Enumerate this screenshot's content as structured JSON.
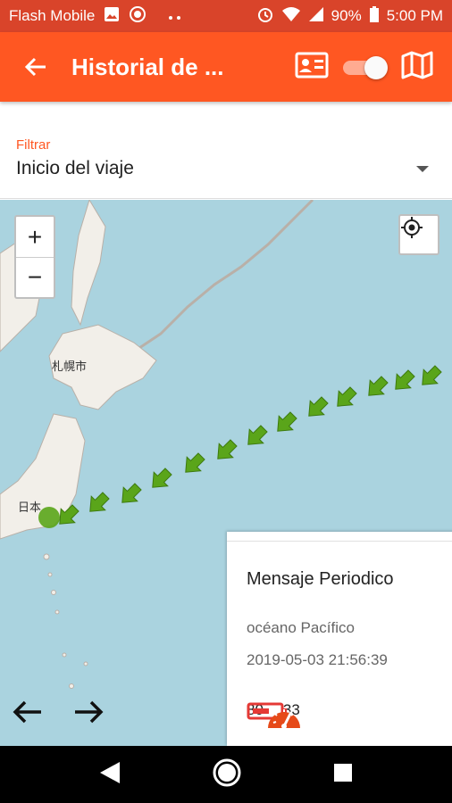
{
  "status_bar": {
    "carrier": "Flash Mobile",
    "battery": "90%",
    "time": "5:00 PM"
  },
  "app_bar": {
    "title": "Historial de ...",
    "icons": [
      "arrow-back-icon",
      "contact-card-icon",
      "map-icon"
    ],
    "toggle_on": true
  },
  "filter": {
    "label": "Filtrar",
    "selected": "Inicio del viaje"
  },
  "map": {
    "zoom_in": "+",
    "zoom_out": "−",
    "labels": [
      {
        "text": "札幌市"
      },
      {
        "text": "日本"
      }
    ],
    "route_color": "#5aa51a",
    "ocean_color": "#aad3df",
    "land_color": "#f2efe9"
  },
  "card": {
    "title": "Mensaje Periodico",
    "location": "océano Pacífico",
    "timestamp": "2019-05-03 21:56:39",
    "battery_value": "80",
    "speed_value": "33"
  },
  "colors": {
    "accent": "#ff5722",
    "status_bar": "#d9442a"
  }
}
